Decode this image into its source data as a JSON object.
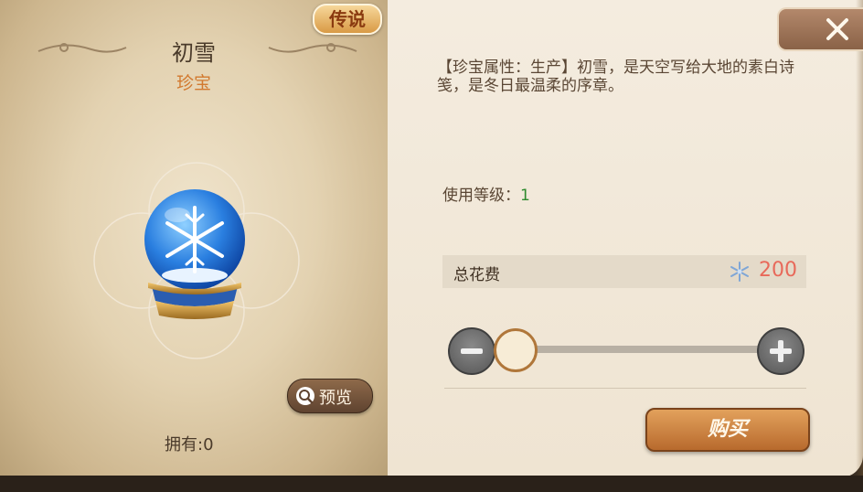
{
  "item": {
    "name": "初雪",
    "type": "珍宝",
    "rarity": "传说",
    "owned_label": "拥有:0",
    "preview_label": "预览"
  },
  "detail": {
    "description": "【珍宝属性：生产】初雪，是天空写给大地的素白诗笺，是冬日最温柔的序章。",
    "level_label": "使用等级：",
    "level_value": "1",
    "cost_label": "总花费",
    "cost_value": "200",
    "buy_label": "购买"
  },
  "quantity_slider": {
    "value": 0
  },
  "colors": {
    "cost": "#e8695a",
    "type": "#d2792f",
    "level": "#2e8b2e"
  },
  "icons": [
    "flourish-icon",
    "snow-globe-icon",
    "search-icon",
    "close-icon",
    "snowflake-currency-icon",
    "minus-icon",
    "plus-icon"
  ]
}
